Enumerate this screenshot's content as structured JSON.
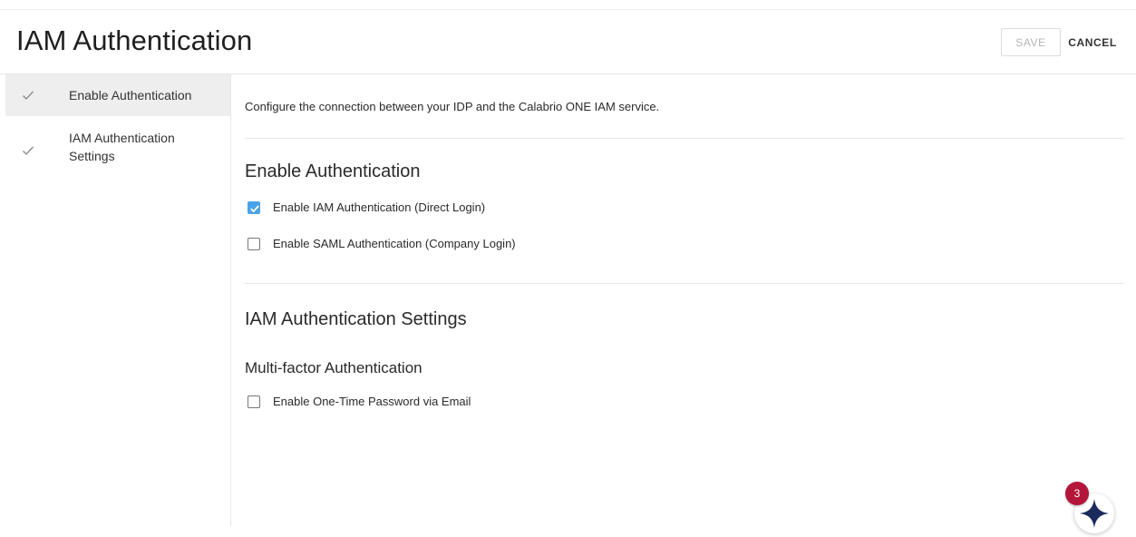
{
  "header": {
    "title": "IAM Authentication",
    "save_label": "SAVE",
    "cancel_label": "CANCEL"
  },
  "sidebar": {
    "items": [
      {
        "label": "Enable Authentication",
        "icon": "check-icon",
        "active": true
      },
      {
        "label": "IAM Authentication Settings",
        "icon": "check-icon",
        "active": false
      }
    ]
  },
  "main": {
    "intro": "Configure the connection between your IDP and the Calabrio ONE IAM service.",
    "enable_section": {
      "title": "Enable Authentication",
      "options": [
        {
          "label": "Enable IAM Authentication (Direct Login)",
          "checked": true
        },
        {
          "label": "Enable SAML Authentication (Company Login)",
          "checked": false
        }
      ]
    },
    "settings_section": {
      "title": "IAM Authentication Settings",
      "subsection_title": "Multi-factor Authentication",
      "options": [
        {
          "label": "Enable One-Time Password via Email",
          "checked": false
        }
      ]
    }
  },
  "assistant": {
    "badge_count": "3",
    "icon": "sparkle-star-icon"
  },
  "colors": {
    "accent": "#4aa3e8",
    "badge": "#b3163a",
    "star": "#1a2a5c"
  }
}
